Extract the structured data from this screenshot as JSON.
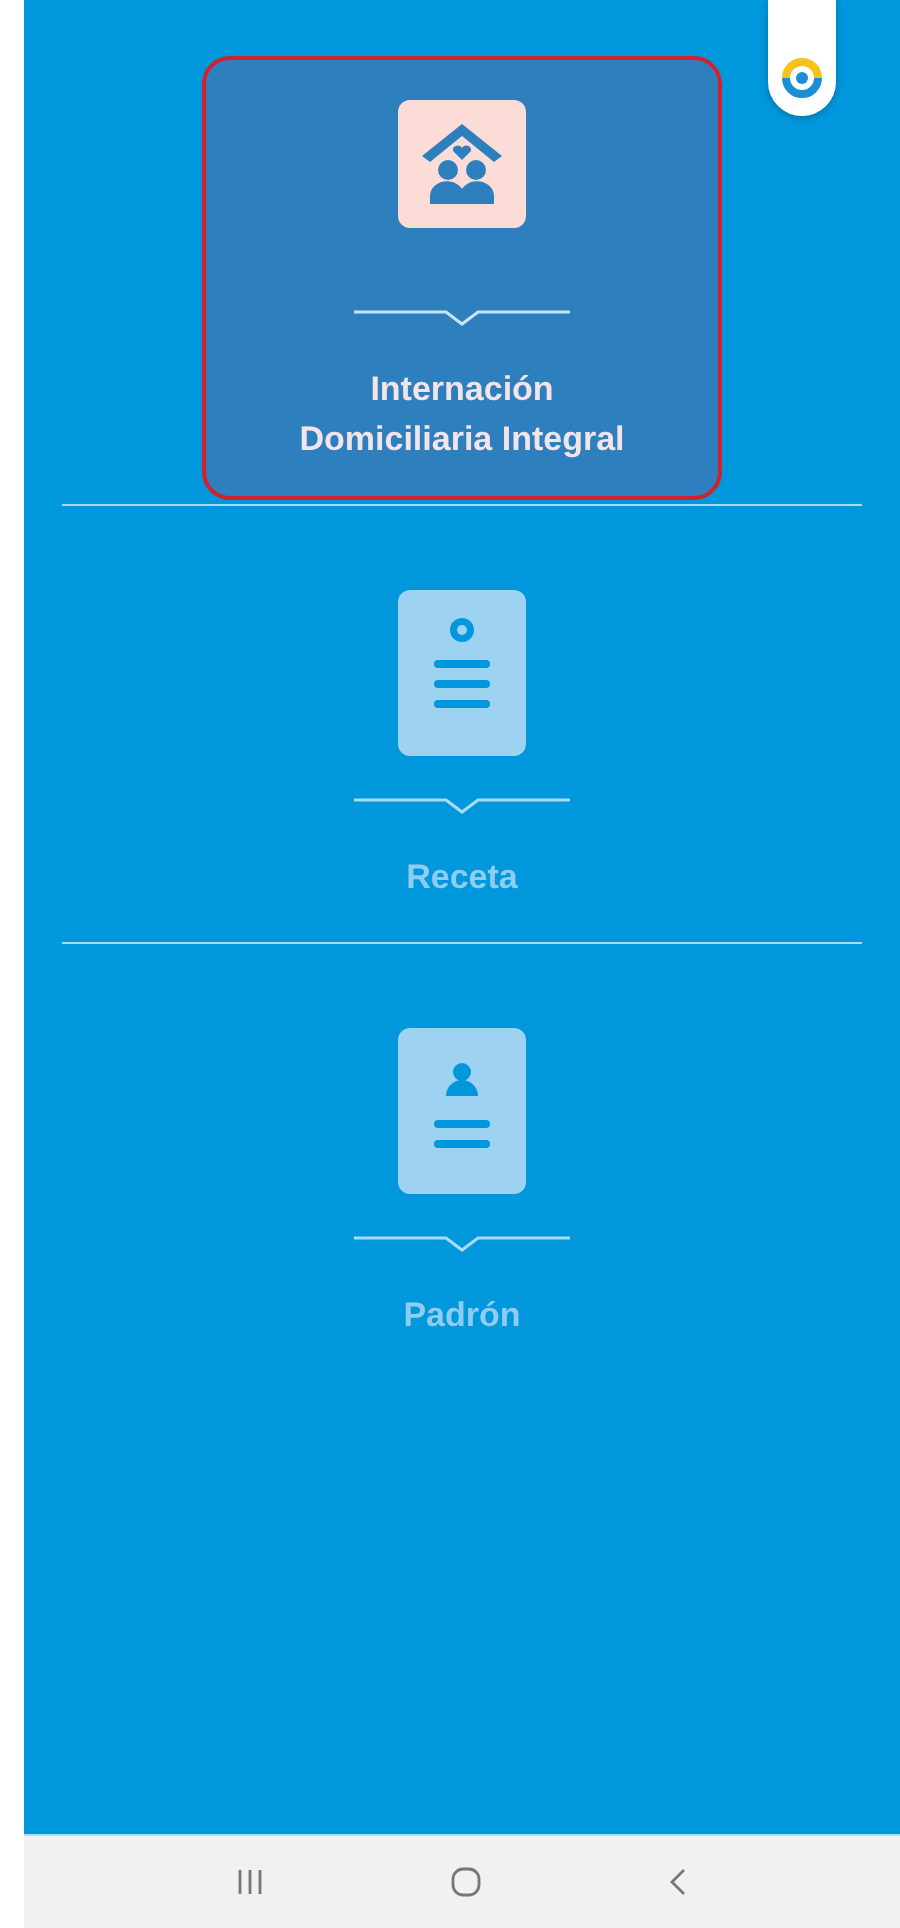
{
  "menu": [
    {
      "label": "Internación\nDomiciliaria Integral",
      "kind": "home-care",
      "selected": true
    },
    {
      "label": "Receta",
      "kind": "prescription",
      "selected": false
    },
    {
      "label": "Padrón",
      "kind": "registry",
      "selected": false
    }
  ]
}
